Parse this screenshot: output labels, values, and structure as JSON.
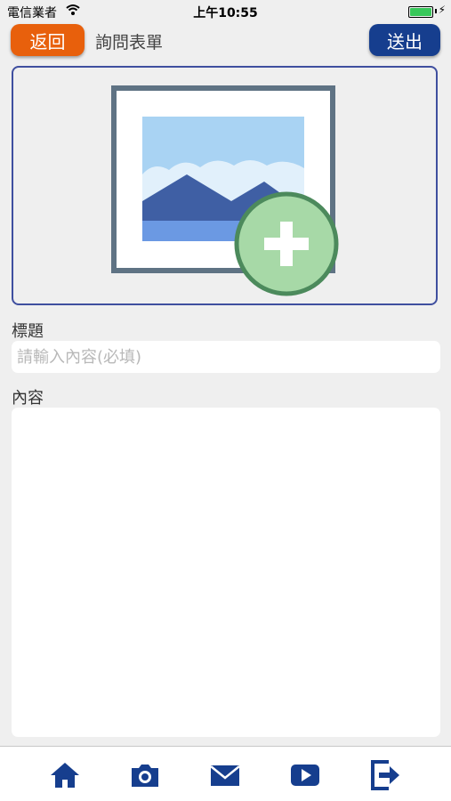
{
  "status_bar": {
    "carrier": "電信業者",
    "time": "上午10:55"
  },
  "header": {
    "back_label": "返回",
    "title": "詢問表單",
    "send_label": "送出"
  },
  "form": {
    "title_label": "標題",
    "title_placeholder": "請輸入內容(必填)",
    "title_value": "",
    "content_label": "內容",
    "content_value": ""
  },
  "tab_bar": {
    "icons": [
      "home-icon",
      "camera-icon",
      "mail-icon",
      "video-play-icon",
      "logout-icon"
    ]
  },
  "colors": {
    "back_button": "#e8600c",
    "send_button": "#163e8e",
    "tab_icon": "#163e8e",
    "add_badge": "#a7d9a7"
  }
}
